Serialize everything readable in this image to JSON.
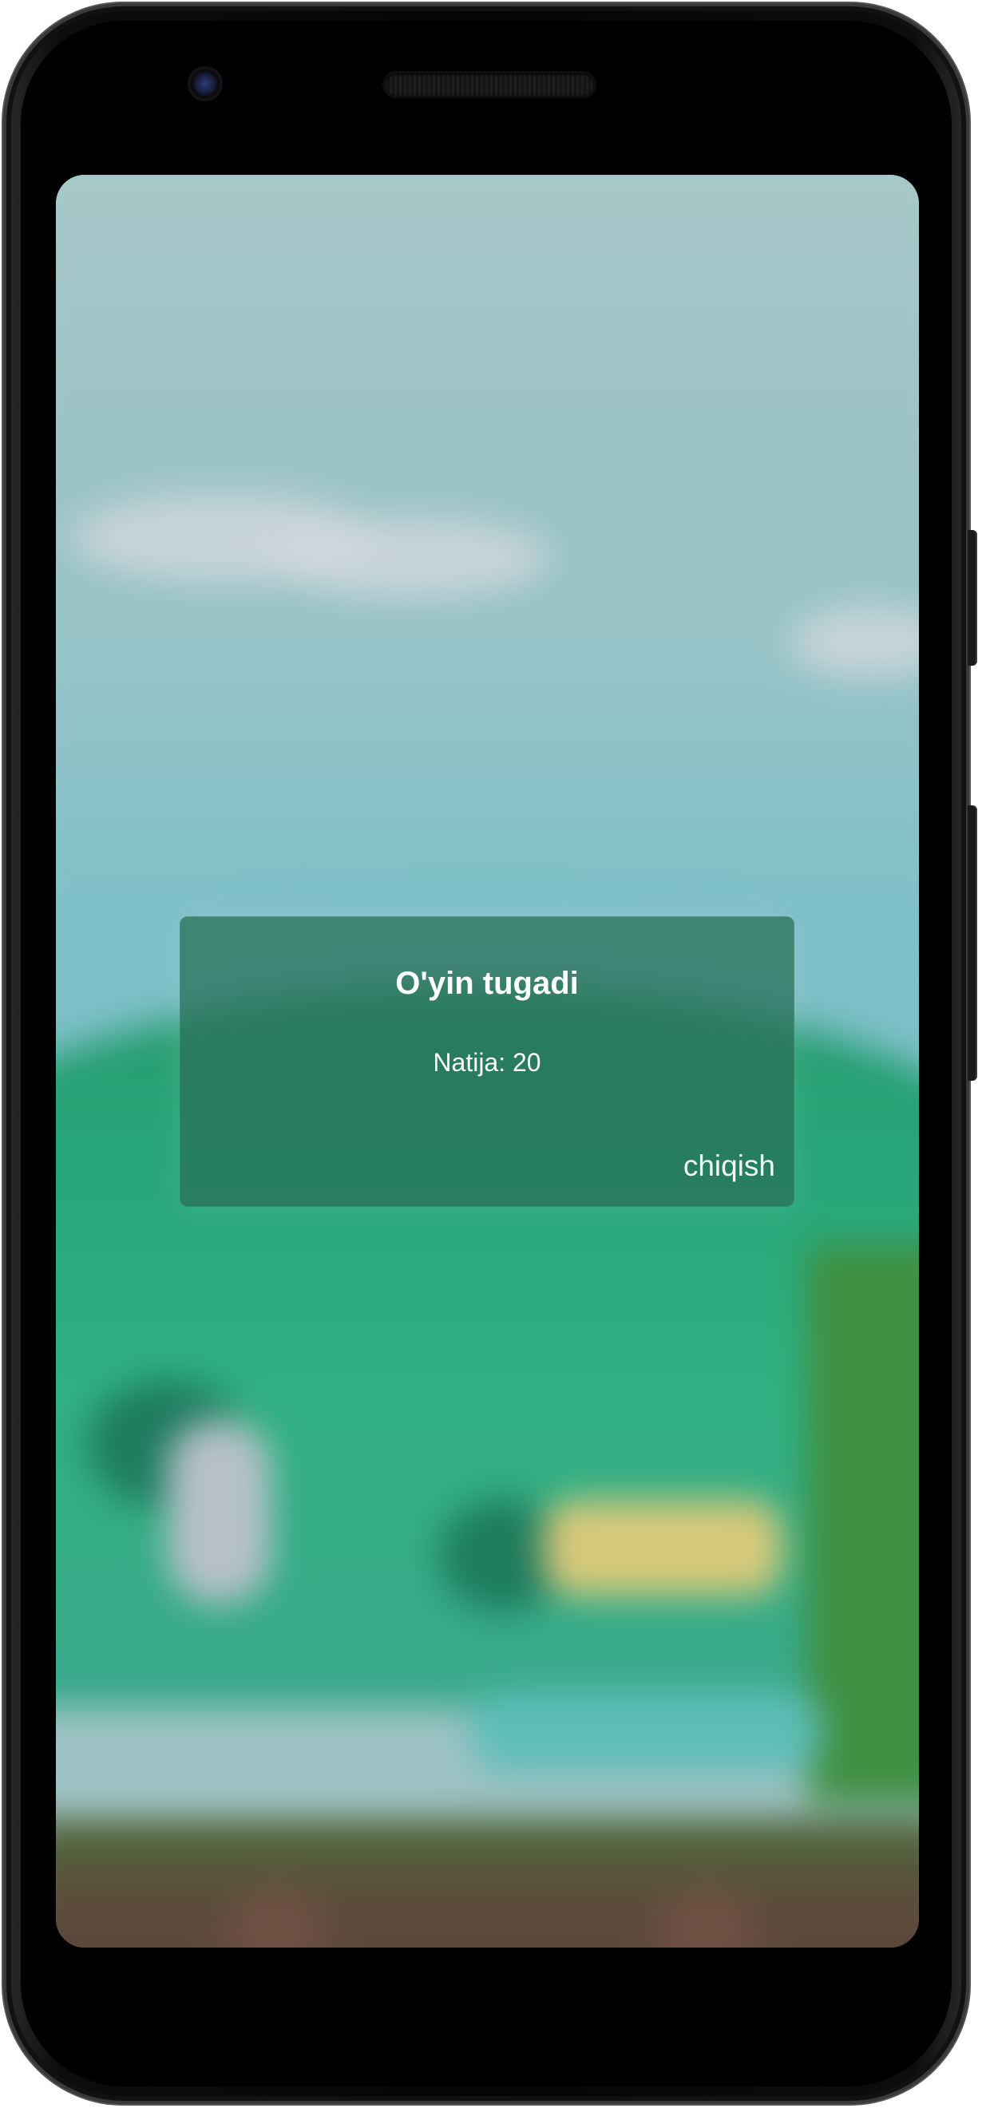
{
  "dialog": {
    "title": "O'yin tugadi",
    "message": "Natija: 20",
    "action_label": "chiqish"
  },
  "colors": {
    "sky": "#9cc3c6",
    "hill": "#2fb082",
    "ground": "#5f4539",
    "dialog_background": "#2e6e55"
  }
}
